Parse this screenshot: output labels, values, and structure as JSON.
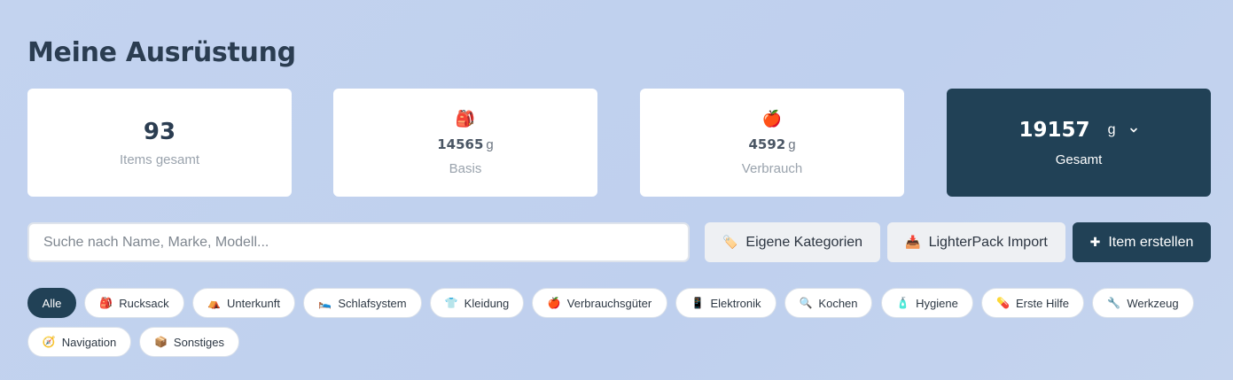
{
  "page": {
    "title": "Meine Ausrüstung"
  },
  "stats": {
    "items": {
      "value": "93",
      "label": "Items gesamt"
    },
    "basis": {
      "icon": "🎒",
      "value": "14565",
      "unit": "g",
      "label": "Basis"
    },
    "verbrauch": {
      "icon": "🍎",
      "value": "4592",
      "unit": "g",
      "label": "Verbrauch"
    },
    "gesamt": {
      "value": "19157",
      "unit": "g",
      "label": "Gesamt"
    }
  },
  "search": {
    "placeholder": "Suche nach Name, Marke, Modell..."
  },
  "actions": {
    "categories": {
      "icon": "🏷️",
      "label": "Eigene Kategorien"
    },
    "import": {
      "icon": "📥",
      "label": "LighterPack Import"
    },
    "create": {
      "icon": "✚",
      "label": "Item erstellen"
    }
  },
  "filters": [
    {
      "icon": "",
      "label": "Alle"
    },
    {
      "icon": "🎒",
      "label": "Rucksack"
    },
    {
      "icon": "⛺",
      "label": "Unterkunft"
    },
    {
      "icon": "🛌",
      "label": "Schlafsystem"
    },
    {
      "icon": "👕",
      "label": "Kleidung"
    },
    {
      "icon": "🍎",
      "label": "Verbrauchsgüter"
    },
    {
      "icon": "📱",
      "label": "Elektronik"
    },
    {
      "icon": "🔍",
      "label": "Kochen"
    },
    {
      "icon": "🧴",
      "label": "Hygiene"
    },
    {
      "icon": "💊",
      "label": "Erste Hilfe"
    },
    {
      "icon": "🔧",
      "label": "Werkzeug"
    },
    {
      "icon": "🧭",
      "label": "Navigation"
    },
    {
      "icon": "📦",
      "label": "Sonstiges"
    }
  ],
  "colors": {
    "accent": "#214156",
    "background": "#c3d3ef"
  }
}
